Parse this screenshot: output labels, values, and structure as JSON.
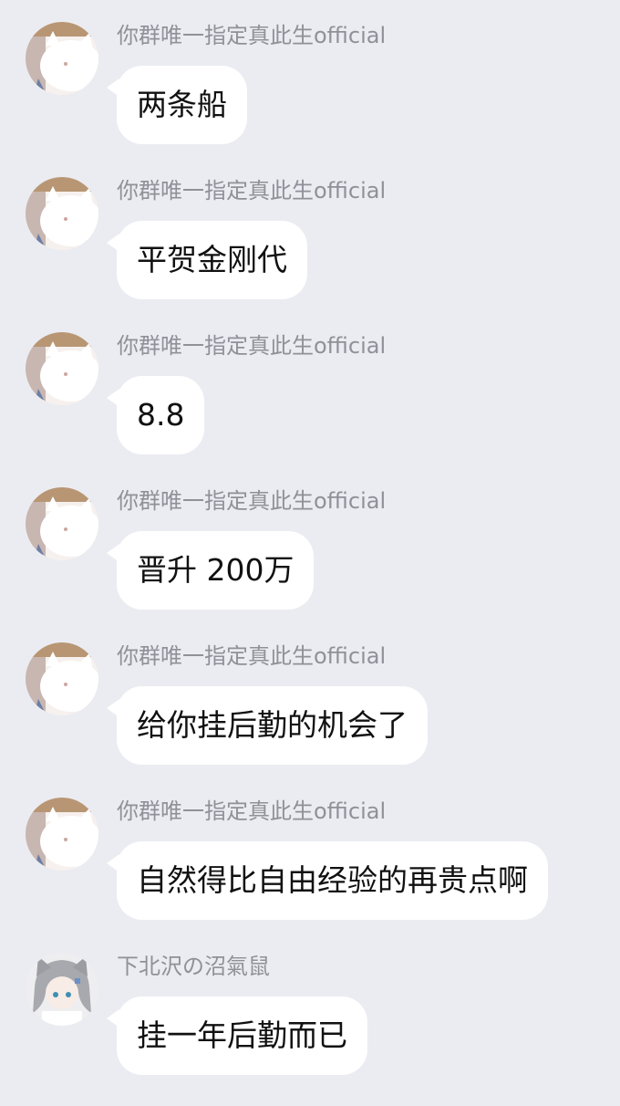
{
  "messages": [
    {
      "sender": "你群唯一指定真此生official",
      "avatar_icon": "cat-avatar-icon",
      "text": "两条船"
    },
    {
      "sender": "你群唯一指定真此生official",
      "avatar_icon": "cat-avatar-icon",
      "text": "平贺金刚代"
    },
    {
      "sender": "你群唯一指定真此生official",
      "avatar_icon": "cat-avatar-icon",
      "text": "8.8"
    },
    {
      "sender": "你群唯一指定真此生official",
      "avatar_icon": "cat-avatar-icon",
      "text": "晋升 200万"
    },
    {
      "sender": "你群唯一指定真此生official",
      "avatar_icon": "cat-avatar-icon",
      "text": "给你挂后勤的机会了"
    },
    {
      "sender": "你群唯一指定真此生official",
      "avatar_icon": "cat-avatar-icon",
      "text": "自然得比自由经验的再贵点啊"
    },
    {
      "sender": "下北沢の沼氣鼠",
      "avatar_icon": "anime-girl-avatar-icon",
      "text": "挂一年后勤而已"
    }
  ],
  "colors": {
    "background": "#ebecf1",
    "bubble": "#ffffff",
    "sender_name": "#8f9199",
    "message_text": "#111111"
  }
}
